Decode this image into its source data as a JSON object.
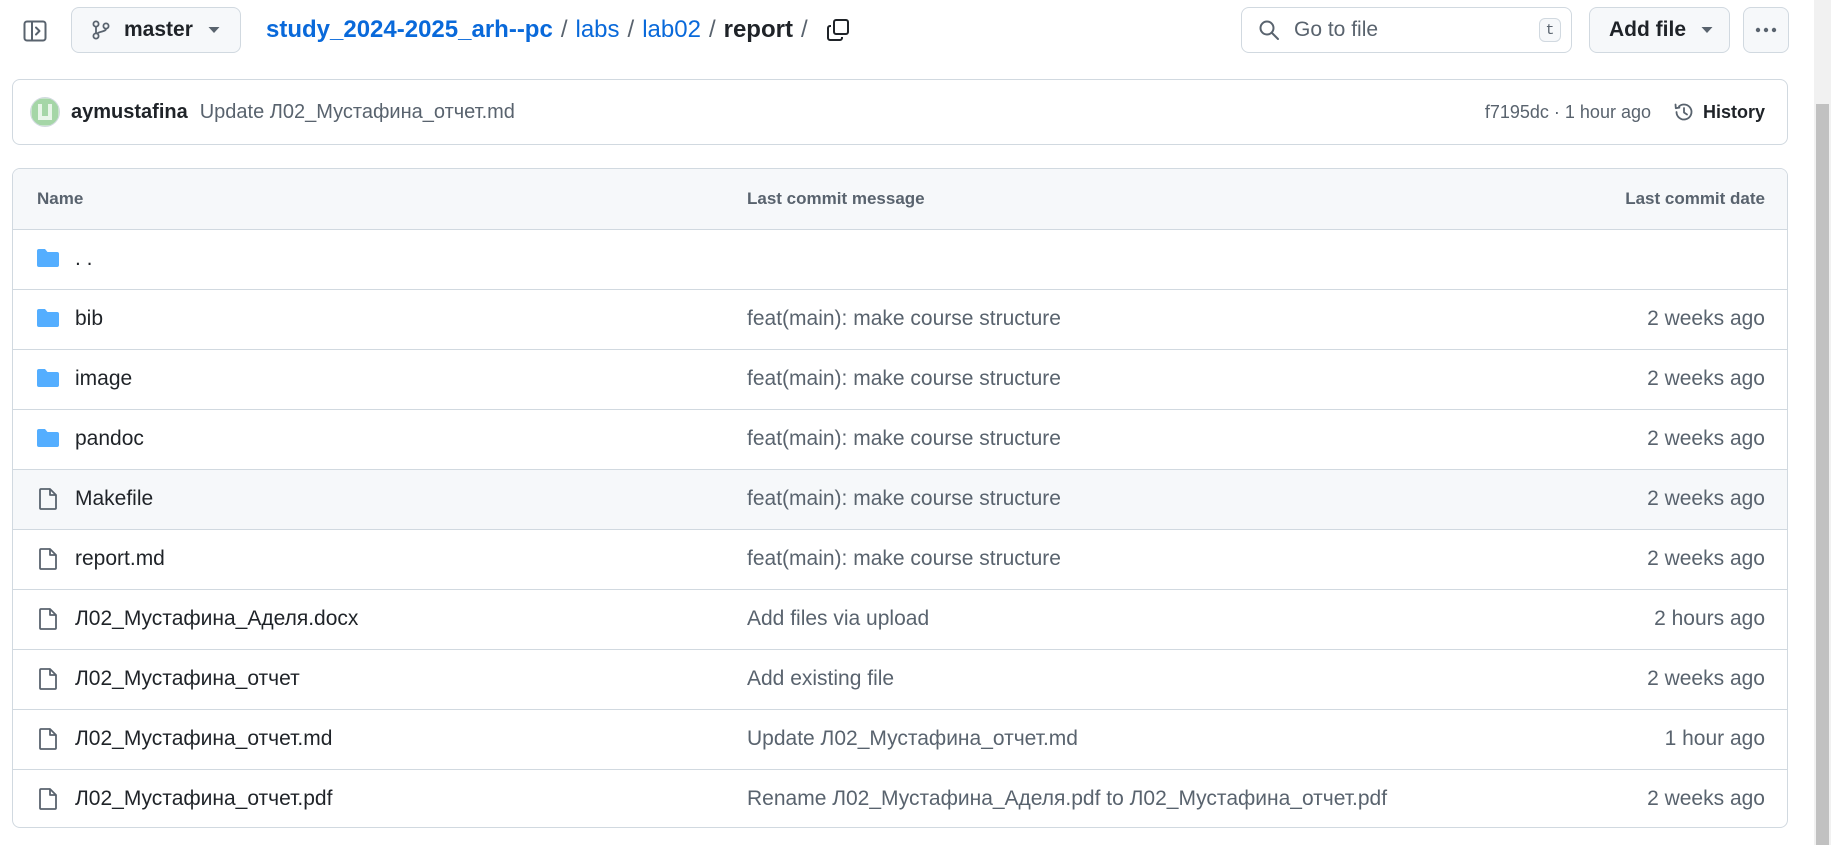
{
  "topbar": {
    "branch": "master",
    "breadcrumb": {
      "repo": "study_2024-2025_arh--pc",
      "parts": [
        "labs",
        "lab02"
      ],
      "current": "report",
      "separator": "/"
    },
    "search_placeholder": "Go to file",
    "search_shortcut": "t",
    "add_file_label": "Add file"
  },
  "commit": {
    "author": "aymustafina",
    "message": "Update Л02_Мустафина_отчет.md",
    "meta": "f7195dc · 1 hour ago",
    "history_label": "History"
  },
  "table": {
    "headers": {
      "name": "Name",
      "message": "Last commit message",
      "date": "Last commit date"
    },
    "parent_label": ". .",
    "rows": [
      {
        "name": "bib",
        "type": "folder",
        "message": "feat(main): make course structure",
        "date": "2 weeks ago"
      },
      {
        "name": "image",
        "type": "folder",
        "message": "feat(main): make course structure",
        "date": "2 weeks ago"
      },
      {
        "name": "pandoc",
        "type": "folder",
        "message": "feat(main): make course structure",
        "date": "2 weeks ago"
      },
      {
        "name": "Makefile",
        "type": "file",
        "message": "feat(main): make course structure",
        "date": "2 weeks ago"
      },
      {
        "name": "report.md",
        "type": "file",
        "message": "feat(main): make course structure",
        "date": "2 weeks ago"
      },
      {
        "name": "Л02_Мустафина_Аделя.docx",
        "type": "file",
        "message": "Add files via upload",
        "date": "2 hours ago"
      },
      {
        "name": "Л02_Мустафина_отчет",
        "type": "file",
        "message": "Add existing file",
        "date": "2 weeks ago"
      },
      {
        "name": "Л02_Мустафина_отчет.md",
        "type": "file",
        "message": "Update Л02_Мустафина_отчет.md",
        "date": "1 hour ago"
      },
      {
        "name": "Л02_Мустафина_отчет.pdf",
        "type": "file",
        "message": "Rename Л02_Мустафина_Аделя.pdf to Л02_Мустафина_отчет.pdf",
        "date": "2 weeks ago"
      }
    ]
  },
  "colors": {
    "link": "#0969da",
    "folder": "#54aeff",
    "muted": "#59636e",
    "border": "#d1d9e0",
    "header_bg": "#f6f8fa"
  }
}
